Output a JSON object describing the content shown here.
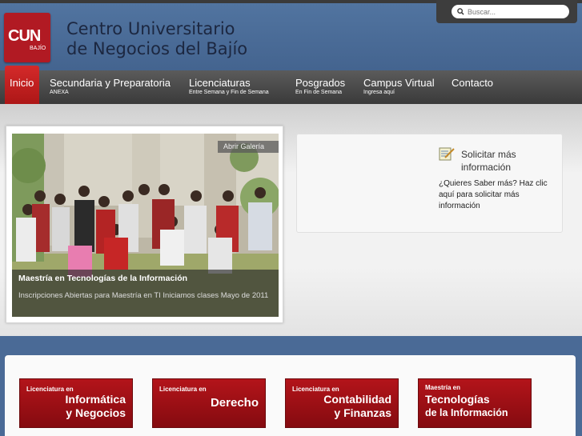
{
  "logo": {
    "main": "CUN",
    "sub": "BAJÍO"
  },
  "brand": {
    "line1": "Centro Universitario",
    "line2": "de Negocios del Bajío"
  },
  "search": {
    "placeholder": "Buscar..."
  },
  "nav": {
    "active": "Inicio",
    "items": [
      {
        "label": "Secundaria y Preparatoria",
        "sub": "ANEXA"
      },
      {
        "label": "Licenciaturas",
        "sub": "Entre Semana y Fin de Semana"
      },
      {
        "label": "Posgrados",
        "sub": "En Fin de Semana"
      },
      {
        "label": "Campus Virtual",
        "sub": "Ingresa aquí"
      },
      {
        "label": "Contacto",
        "sub": ""
      }
    ]
  },
  "slider": {
    "gallery": "Abrir Galería",
    "caption_title": "Maestría en Tecnologías de la Información",
    "caption_text": "Inscripciones Abiertas para Maestría en TI Iniciamos clases Mayo de 2011"
  },
  "info": {
    "title": "Solicitar más información",
    "text": "¿Quieres Saber más? Haz clic aquí para solicitar más información"
  },
  "programs": [
    {
      "line1": "Licenciatura en",
      "line2": "Informática",
      "line3": "y Negocios"
    },
    {
      "line1": "Licenciatura en",
      "line2": "Derecho",
      "line3": ""
    },
    {
      "line1": "Licenciatura en",
      "line2": "Contabilidad",
      "line3": "y Finanzas"
    },
    {
      "line1": "Maestría en",
      "line2": "Tecnologías",
      "line3": "de la Información"
    }
  ],
  "colors": {
    "accent": "#b11a23",
    "header": "#4a6a96",
    "nav": "#3a3a3a"
  }
}
